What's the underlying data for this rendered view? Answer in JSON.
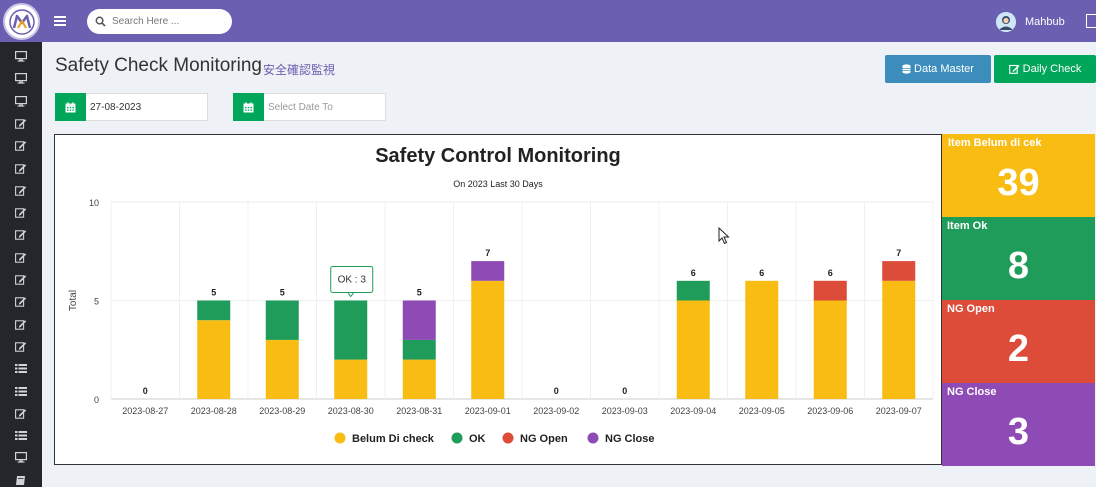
{
  "header": {
    "search_placeholder": "Search Here ...",
    "user_name": "Mahbub"
  },
  "page": {
    "title": "Safety Check Monitoring",
    "subtitle": "安全確認監視"
  },
  "buttons": {
    "data_master": "Data Master",
    "daily_check": "Daily Check"
  },
  "filters": {
    "date_from_value": "27-08-2023",
    "date_to_placeholder": "Select Date To"
  },
  "sidebar": {
    "icons": [
      "monitor-icon",
      "monitor-icon",
      "monitor-icon",
      "edit-icon",
      "edit-icon",
      "edit-icon",
      "edit-icon",
      "edit-icon",
      "edit-icon",
      "edit-icon",
      "edit-icon",
      "edit-icon",
      "edit-icon",
      "edit-icon",
      "list-icon",
      "list-icon",
      "edit-icon",
      "list-icon",
      "monitor-icon",
      "book-icon",
      "edit-icon"
    ]
  },
  "tooltip": {
    "text": "OK : 3"
  },
  "stats": {
    "belum_label": "Item Belum di cek",
    "belum_value": "39",
    "ok_label": "Item Ok",
    "ok_value": "8",
    "ngopen_label": "NG Open",
    "ngopen_value": "2",
    "ngclose_label": "NG Close",
    "ngclose_value": "3"
  },
  "colors": {
    "belum": "#f9bc12",
    "ok": "#1f9c5a",
    "ngopen": "#dd4b39",
    "ngclose": "#8e4ab5"
  },
  "chart_data": {
    "type": "bar",
    "stacked": true,
    "title": "Safety Control Monitoring",
    "subtitle": "On 2023 Last 30 Days",
    "ylabel": "Total",
    "xlabel": "",
    "ylim": [
      0,
      10
    ],
    "yticks": [
      0,
      5,
      10
    ],
    "grid": true,
    "legend_position": "bottom",
    "categories": [
      "2023-08-27",
      "2023-08-28",
      "2023-08-29",
      "2023-08-30",
      "2023-08-31",
      "2023-09-01",
      "2023-09-02",
      "2023-09-03",
      "2023-09-04",
      "2023-09-05",
      "2023-09-06",
      "2023-09-07"
    ],
    "series": [
      {
        "name": "Belum Di check",
        "color": "#f9bc12",
        "values": [
          0,
          4,
          3,
          2,
          2,
          6,
          0,
          0,
          5,
          6,
          5,
          6
        ]
      },
      {
        "name": "OK",
        "color": "#1f9c5a",
        "values": [
          0,
          1,
          2,
          3,
          1,
          0,
          0,
          0,
          1,
          0,
          0,
          0
        ]
      },
      {
        "name": "NG Open",
        "color": "#dd4b39",
        "values": [
          0,
          0,
          0,
          0,
          0,
          0,
          0,
          0,
          0,
          0,
          1,
          1
        ]
      },
      {
        "name": "NG Close",
        "color": "#8e4ab5",
        "values": [
          0,
          0,
          0,
          0,
          2,
          1,
          0,
          0,
          0,
          0,
          0,
          0
        ]
      }
    ],
    "totals": [
      0,
      5,
      5,
      5,
      5,
      7,
      0,
      0,
      6,
      6,
      6,
      7
    ]
  }
}
